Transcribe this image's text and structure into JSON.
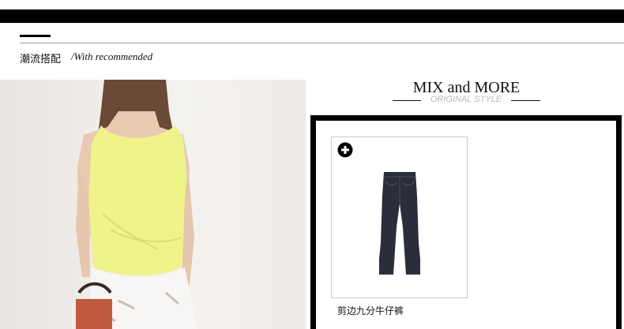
{
  "section": {
    "title": "潮流搭配",
    "subtitle": "/With recommended"
  },
  "mix": {
    "title": "MIX and MORE",
    "subtitle": "ORIGINAL STYLE"
  },
  "product": {
    "name": "剪边九分牛仔裤",
    "icon": "plus-circle-icon"
  },
  "colors": {
    "bar": "#000000",
    "top_color": "#eef38a",
    "denim": "#2a2d3a"
  }
}
